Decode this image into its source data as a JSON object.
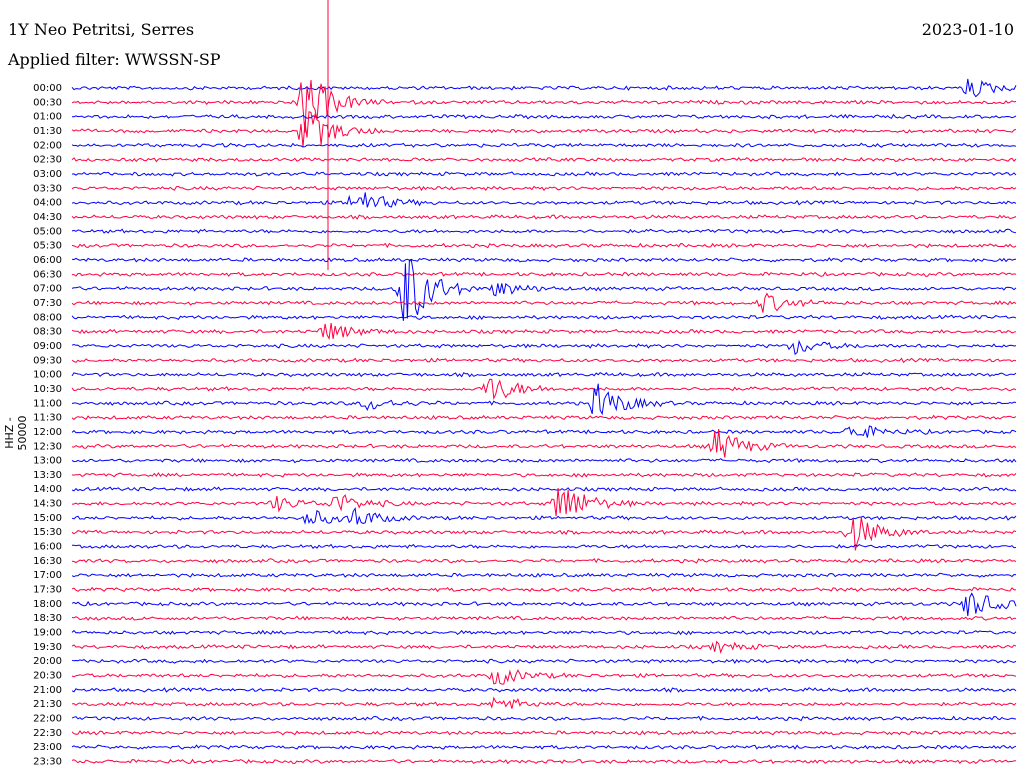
{
  "header": {
    "station": "1Y Neo Petritsi, Serres",
    "filter": "Applied filter: WWSSN-SP",
    "date": "2023-01-10"
  },
  "axis": {
    "ylabel": "HHZ - 50000"
  },
  "colors": {
    "trace_a": "#0000ff",
    "trace_b": "#ff0040",
    "background": "#ffffff"
  },
  "chart_data": {
    "type": "line",
    "title": "",
    "ylabel": "HHZ - 50000",
    "row_labels": [
      "00:00",
      "00:30",
      "01:00",
      "01:30",
      "02:00",
      "02:30",
      "03:00",
      "03:30",
      "04:00",
      "04:30",
      "05:00",
      "05:30",
      "06:00",
      "06:30",
      "07:00",
      "07:30",
      "08:00",
      "08:30",
      "09:00",
      "09:30",
      "10:00",
      "10:30",
      "11:00",
      "11:30",
      "12:00",
      "12:30",
      "13:00",
      "13:30",
      "14:00",
      "14:30",
      "15:00",
      "15:30",
      "16:00",
      "16:30",
      "17:00",
      "17:30",
      "18:00",
      "18:30",
      "19:00",
      "19:30",
      "20:00",
      "20:30",
      "21:00",
      "21:30",
      "22:00",
      "22:30",
      "23:00",
      "23:30"
    ],
    "row_minutes": 30,
    "series": [
      {
        "values": []
      },
      {
        "values": []
      }
    ],
    "events": [
      {
        "row": 0,
        "minute": 28.5,
        "amp": 1.0
      },
      {
        "row": 1,
        "minute": 7.4,
        "amp": 3.5
      },
      {
        "row": 3,
        "minute": 7.4,
        "amp": 2.5
      },
      {
        "row": 8,
        "minute": 9.0,
        "amp": 1.5
      },
      {
        "row": 14,
        "minute": 10.5,
        "amp": 5.0
      },
      {
        "row": 14,
        "minute": 13.5,
        "amp": 0.8
      },
      {
        "row": 15,
        "minute": 22.0,
        "amp": 1.0
      },
      {
        "row": 17,
        "minute": 8.1,
        "amp": 1.0
      },
      {
        "row": 18,
        "minute": 23.0,
        "amp": 0.8
      },
      {
        "row": 21,
        "minute": 13.3,
        "amp": 1.5
      },
      {
        "row": 22,
        "minute": 9.4,
        "amp": 0.7
      },
      {
        "row": 22,
        "minute": 16.7,
        "amp": 2.0
      },
      {
        "row": 24,
        "minute": 24.8,
        "amp": 0.9
      },
      {
        "row": 25,
        "minute": 20.5,
        "amp": 1.8
      },
      {
        "row": 29,
        "minute": 15.5,
        "amp": 2.5
      },
      {
        "row": 29,
        "minute": 6.5,
        "amp": 0.7
      },
      {
        "row": 29,
        "minute": 8.4,
        "amp": 1.0
      },
      {
        "row": 30,
        "minute": 7.5,
        "amp": 0.9
      },
      {
        "row": 30,
        "minute": 9.0,
        "amp": 0.9
      },
      {
        "row": 31,
        "minute": 24.8,
        "amp": 2.0
      },
      {
        "row": 36,
        "minute": 28.5,
        "amp": 1.5
      },
      {
        "row": 39,
        "minute": 20.5,
        "amp": 0.5
      },
      {
        "row": 41,
        "minute": 13.5,
        "amp": 1.0
      },
      {
        "row": 43,
        "minute": 13.5,
        "amp": 0.8
      }
    ]
  }
}
